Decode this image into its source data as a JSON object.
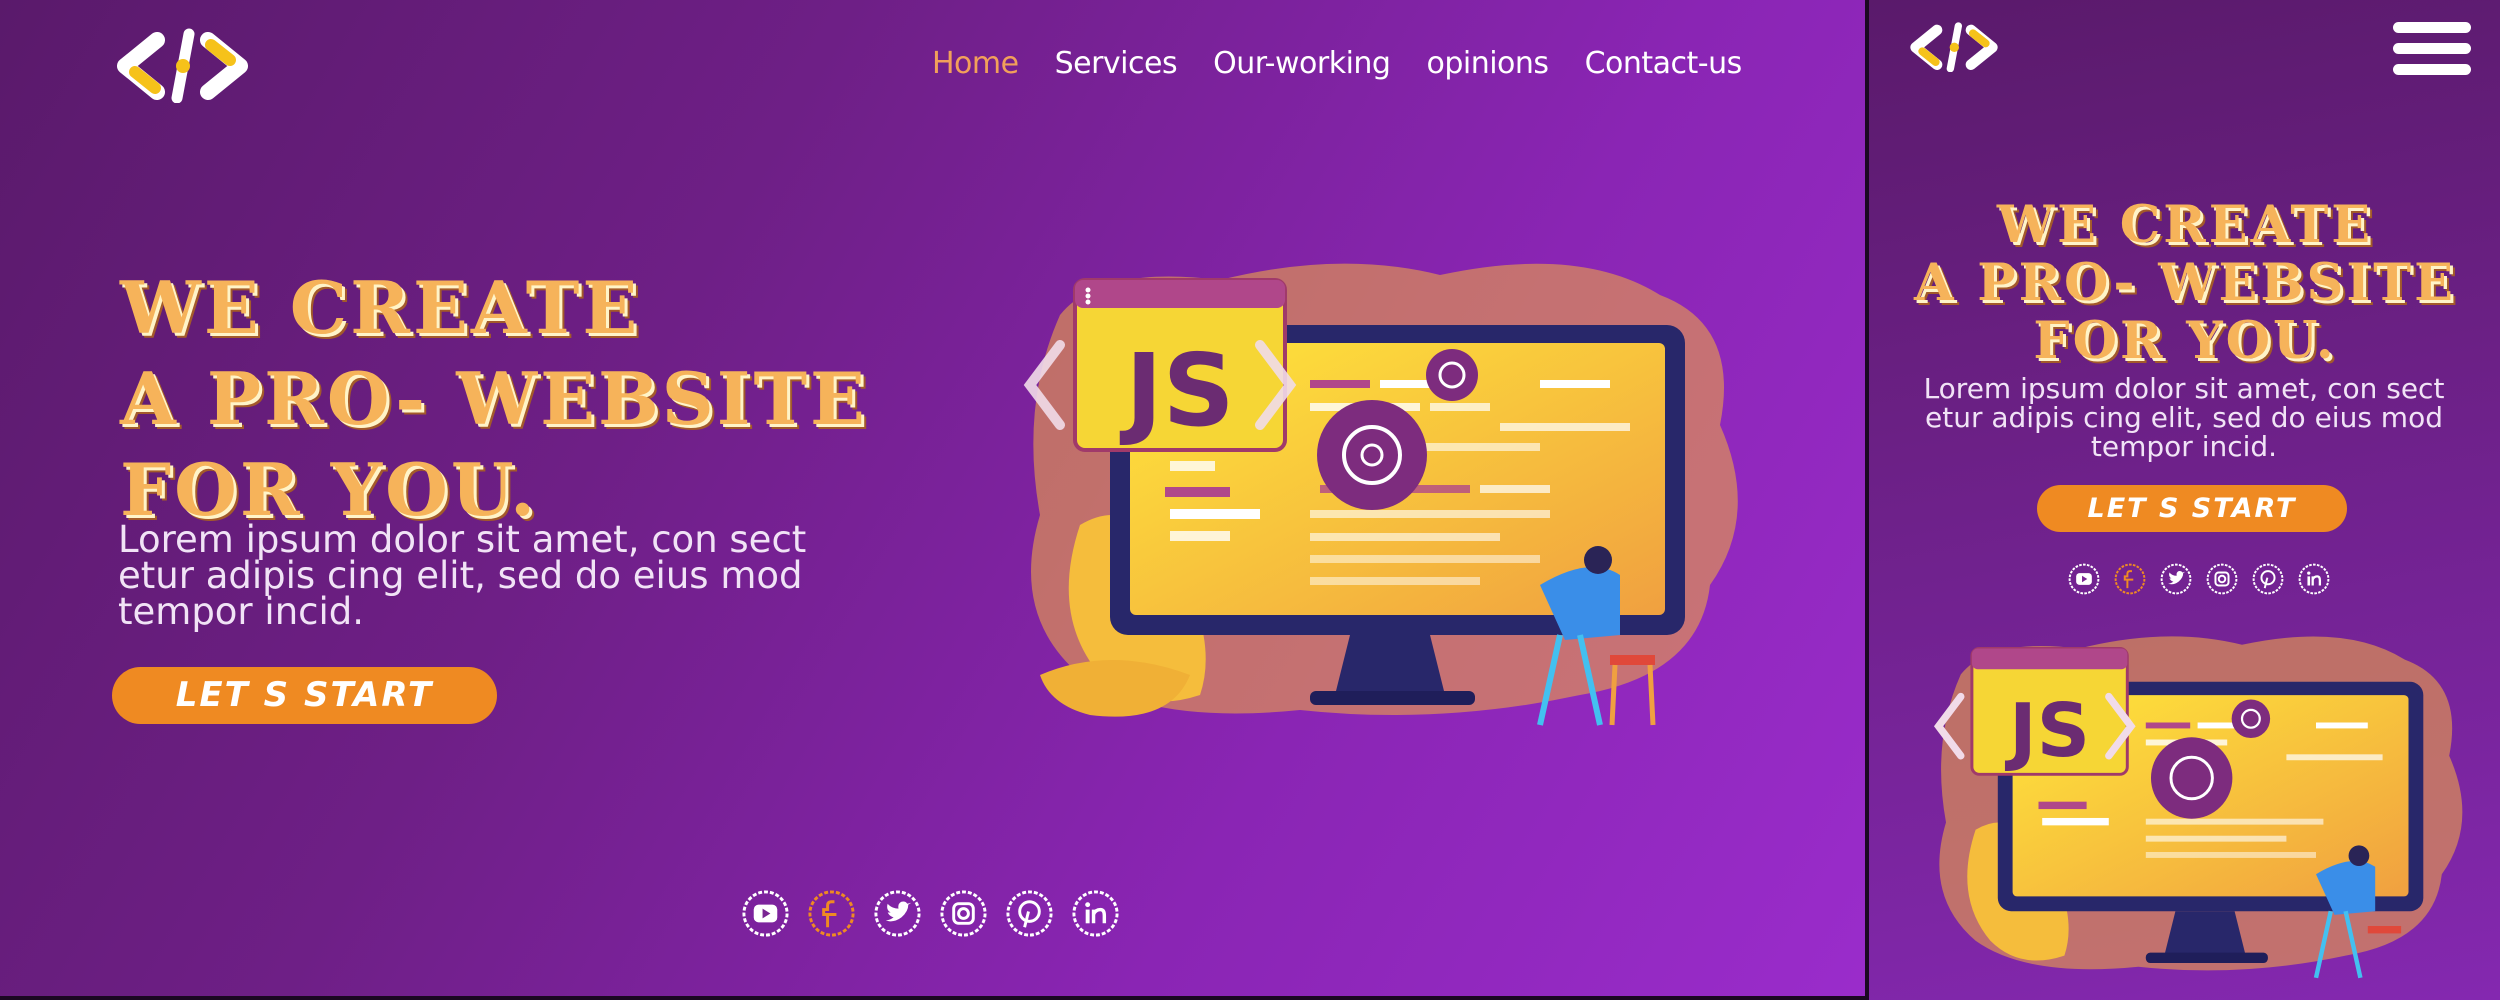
{
  "logo": {
    "icon": "code-brackets-logo"
  },
  "nav": {
    "items": [
      {
        "label": "Home",
        "active": true
      },
      {
        "label": "Services"
      },
      {
        "label": "Our-working"
      },
      {
        "label": "opinions"
      },
      {
        "label": "Contact-us"
      }
    ]
  },
  "hero": {
    "headline_lines": [
      "WE CREATE",
      "A PRO- WEBSITE",
      "FOR YOU."
    ],
    "description": "Lorem ipsum dolor sit amet, con sect etur adipis cing elit, sed do eius mod tempor incid.",
    "mobile_description": "Lorem ipsum dolor sit amet, con sect etur adipis cing elit, sed do eius mod tempor incid.",
    "cta_label": "LET S  START",
    "illustration_badge": "JS"
  },
  "social": [
    {
      "icon": "youtube-icon"
    },
    {
      "icon": "facebook-icon",
      "active": true
    },
    {
      "icon": "twitter-icon"
    },
    {
      "icon": "instagram-icon"
    },
    {
      "icon": "pinterest-icon"
    },
    {
      "icon": "linkedin-icon"
    }
  ],
  "colors": {
    "accent": "#ef8a22",
    "headline": "#f6b35a",
    "nav_active": "#f2a05a",
    "bg_dark": "#5a1a6b",
    "bg_light": "#9a2ccb"
  }
}
